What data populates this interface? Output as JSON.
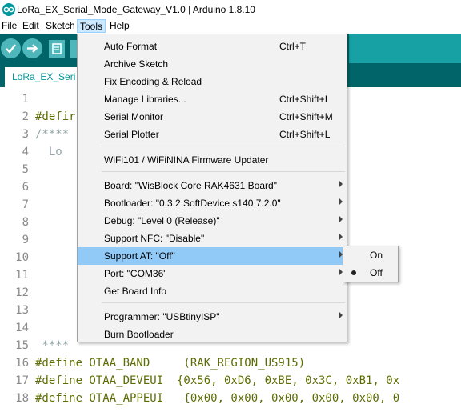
{
  "window": {
    "title": "LoRa_EX_Serial_Mode_Gateway_V1.0 | Arduino 1.8.10"
  },
  "menubar": {
    "items": [
      "File",
      "Edit",
      "Sketch",
      "Tools",
      "Help"
    ],
    "active": "Tools"
  },
  "tab": {
    "label": "LoRa_EX_Seri"
  },
  "editor": {
    "lines": [
      {
        "n": "1",
        "text": ""
      },
      {
        "n": "2",
        "text": "#defir"
      },
      {
        "n": "3",
        "text": "/****"
      },
      {
        "n": "4",
        "text": "  Lo"
      },
      {
        "n": "5",
        "text": ""
      },
      {
        "n": "6",
        "text": ""
      },
      {
        "n": "7",
        "text": ""
      },
      {
        "n": "8",
        "text": ""
      },
      {
        "n": "9",
        "text": ""
      },
      {
        "n": "10",
        "text": ""
      },
      {
        "n": "11",
        "text": ""
      },
      {
        "n": "12",
        "text": ""
      },
      {
        "n": "13",
        "text": ""
      },
      {
        "n": "14",
        "text": ""
      },
      {
        "n": "15",
        "text": " ****"
      },
      {
        "n": "16",
        "text": "#define OTAA_BAND     (RAK_REGION_US915)"
      },
      {
        "n": "17",
        "text": "#define OTAA_DEVEUI  {0x56, 0xD6, 0xBE, 0x3C, 0xB1, 0x"
      },
      {
        "n": "18",
        "text": "#define OTAA_APPEUI   {0x00, 0x00, 0x00, 0x00, 0x00, 0"
      }
    ]
  },
  "tools_menu": {
    "items": [
      {
        "label": "Auto Format",
        "shortcut": "Ctrl+T"
      },
      {
        "label": "Archive Sketch",
        "shortcut": ""
      },
      {
        "label": "Fix Encoding & Reload",
        "shortcut": ""
      },
      {
        "label": "Manage Libraries...",
        "shortcut": "Ctrl+Shift+I"
      },
      {
        "label": "Serial Monitor",
        "shortcut": "Ctrl+Shift+M"
      },
      {
        "label": "Serial Plotter",
        "shortcut": "Ctrl+Shift+L"
      },
      {
        "label": "WiFi101 / WiFiNINA Firmware Updater",
        "shortcut": ""
      },
      {
        "label": "Board: \"WisBlock Core RAK4631 Board\"",
        "shortcut": ""
      },
      {
        "label": "Bootloader: \"0.3.2 SoftDevice s140 7.2.0\"",
        "shortcut": ""
      },
      {
        "label": "Debug: \"Level 0 (Release)\"",
        "shortcut": ""
      },
      {
        "label": "Support NFC: \"Disable\"",
        "shortcut": ""
      },
      {
        "label": "Support AT: \"Off\"",
        "shortcut": ""
      },
      {
        "label": "Port: \"COM36\"",
        "shortcut": ""
      },
      {
        "label": "Get Board Info",
        "shortcut": ""
      },
      {
        "label": "Programmer: \"USBtinyISP\"",
        "shortcut": ""
      },
      {
        "label": "Burn Bootloader",
        "shortcut": ""
      }
    ]
  },
  "support_at_submenu": {
    "items": [
      "On",
      "Off"
    ],
    "selected": "Off"
  },
  "colors": {
    "toolbar": "#006468",
    "accent": "#00979c",
    "highlight": "#91c9f7"
  }
}
